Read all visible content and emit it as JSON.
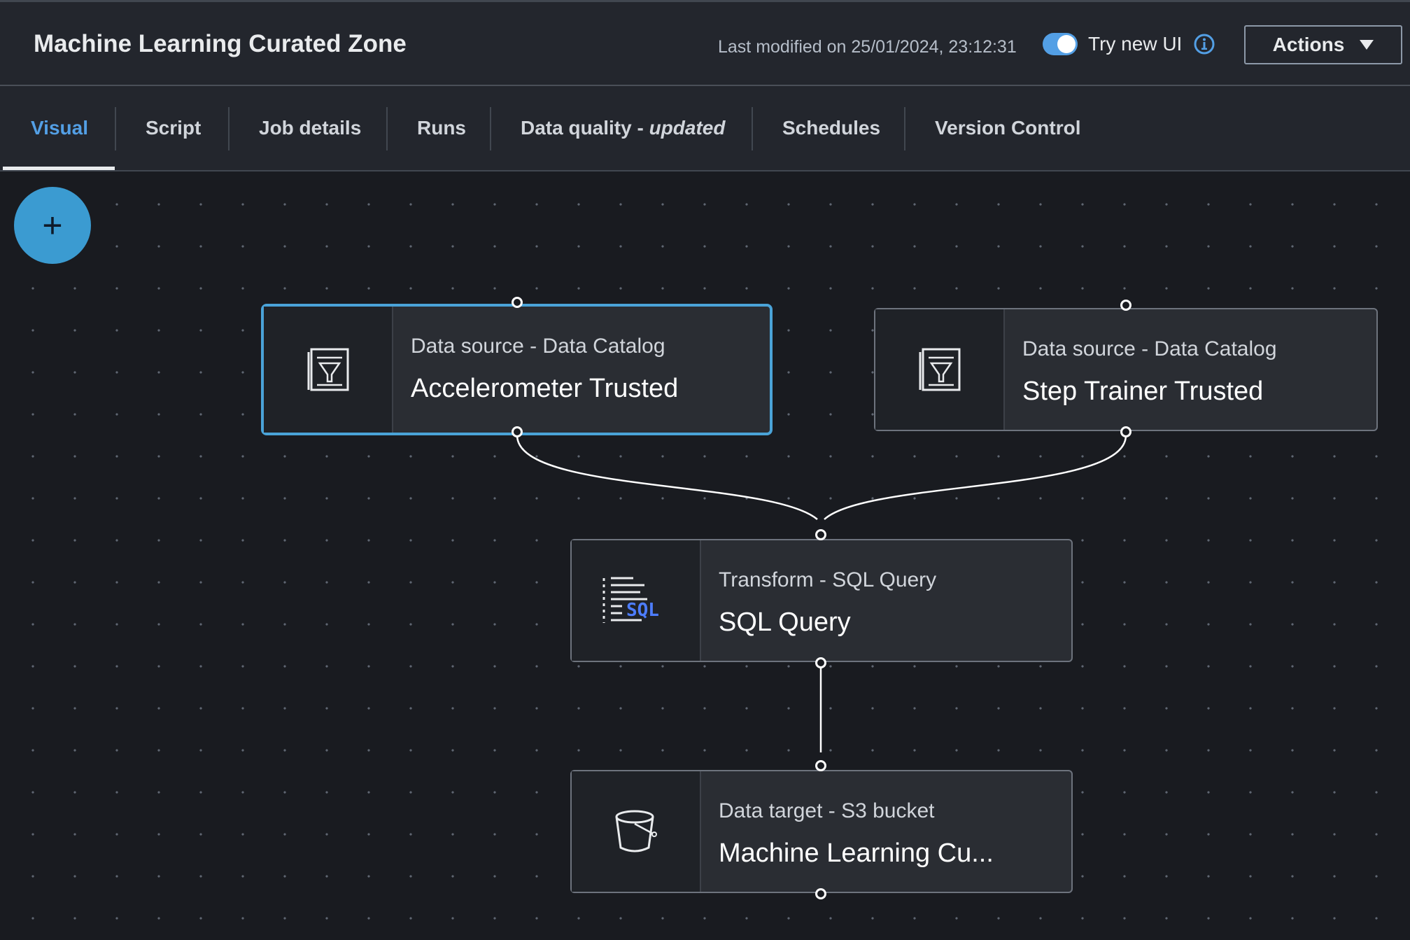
{
  "header": {
    "title": "Machine Learning Curated Zone",
    "last_modified": "Last modified on 25/01/2024, 23:12:31",
    "try_new_ui_label": "Try new UI",
    "try_new_ui_enabled": true,
    "actions_label": "Actions"
  },
  "tabs": [
    {
      "label": "Visual",
      "active": true
    },
    {
      "label": "Script"
    },
    {
      "label": "Job details"
    },
    {
      "label": "Runs"
    },
    {
      "label": "Data quality - ",
      "label_em": "updated"
    },
    {
      "label": "Schedules"
    },
    {
      "label": "Version Control"
    }
  ],
  "canvas": {
    "add_button_label": "+",
    "nodes": [
      {
        "kind": "Data source - Data Catalog",
        "name": "Accelerometer Trusted",
        "icon": "data-catalog-icon",
        "selected": true
      },
      {
        "kind": "Data source - Data Catalog",
        "name": "Step Trainer Trusted",
        "icon": "data-catalog-icon"
      },
      {
        "kind": "Transform - SQL Query",
        "name": "SQL Query",
        "icon": "sql-icon",
        "icon_text": "SQL"
      },
      {
        "kind": "Data target - S3 bucket",
        "name": "Machine Learning Cu...",
        "icon": "s3-bucket-icon"
      }
    ]
  },
  "colors": {
    "accent": "#539fe5",
    "selected_border": "#4aa3d8",
    "add_button": "#3b9bd1",
    "sql_blue": "#4d7dff"
  }
}
